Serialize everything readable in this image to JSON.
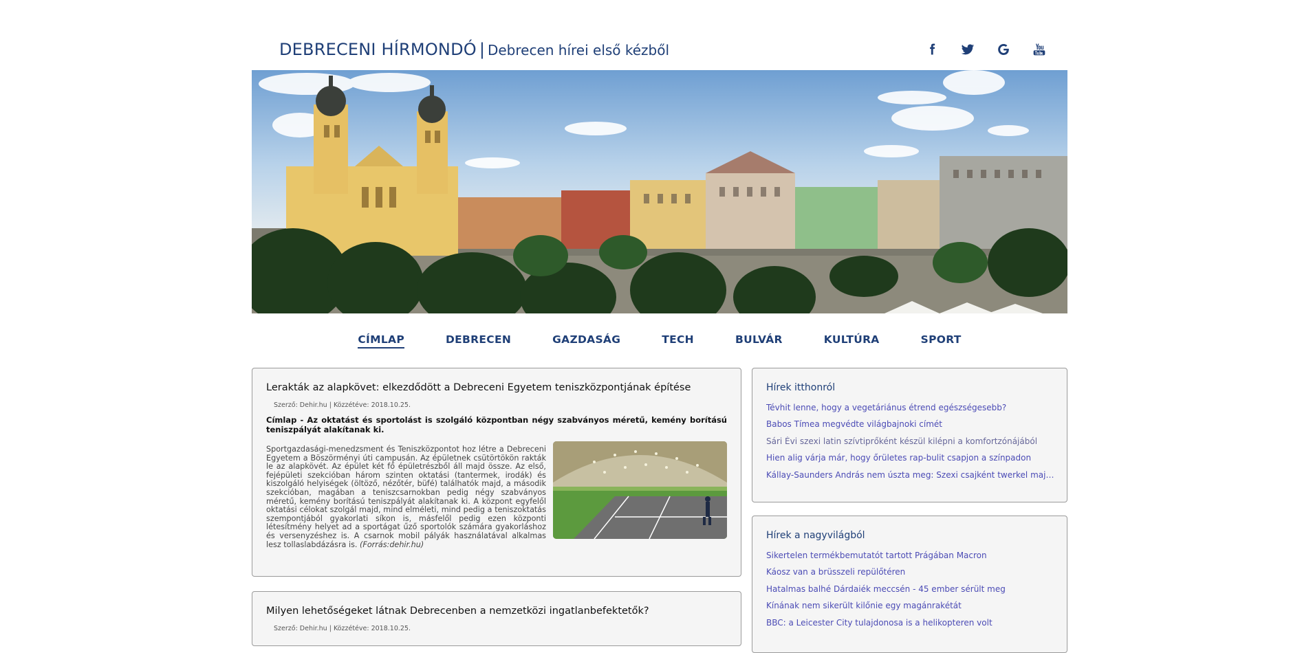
{
  "header": {
    "brand": "DEBRECENI HÍRMONDÓ",
    "separator": "|",
    "tagline": "Debrecen hírei első kézből",
    "socials": [
      {
        "icon": "facebook-icon"
      },
      {
        "icon": "twitter-icon"
      },
      {
        "icon": "google-icon"
      },
      {
        "icon": "youtube-icon"
      }
    ]
  },
  "nav": {
    "items": [
      {
        "label": "CÍMLAP",
        "active": true
      },
      {
        "label": "DEBRECEN"
      },
      {
        "label": "GAZDASÁG"
      },
      {
        "label": "TECH"
      },
      {
        "label": "BULVÁR"
      },
      {
        "label": "KULTÚRA"
      },
      {
        "label": "SPORT"
      }
    ]
  },
  "articles": [
    {
      "title": "Lerakták az alapkövet: elkezdődött a Debreceni Egyetem teniszközpontjának építése",
      "meta": "Szerző: Dehir.hu | Közzétéve: 2018.10.25.",
      "lead": "Címlap - Az oktatást és sportolást is szolgáló központban négy szabványos méretű, kemény borítású teniszpályát alakítanak ki.",
      "body": "Sportgazdasági-menedzsment és Teniszközpontot hoz létre a Debreceni Egyetem a Böszörményi úti campusán. Az épületnek csütörtökön rakták le az alapkövét. Az épület két fő épületrészből áll majd össze. Az első, fejépületi szekcióban három szinten oktatási (tantermek, irodák) és kiszolgáló helyiségek (öltöző, nézőtér, büfé) találhatók majd, a második szekcióban, magában a teniszcsarnokban pedig négy szabványos méretű, kemény borítású teniszpályát alakítanak ki. A központ egyfelől oktatási célokat szolgál majd, mind elméleti, mind pedig a teniszoktatás szempontjából gyakorlati síkon is, másfelől pedig ezen központi létesítmény helyet ad a sportágat űző sportolók számára gyakorláshoz és versenyzéshez is. A csarnok mobil pályák használatával alkalmas lesz tollaslabdázásra is.",
      "source": "(Forrás:dehir.hu)"
    },
    {
      "title": "Milyen lehetőségeket látnak Debrecenben a nemzetközi ingatlanbefektetők?",
      "meta": "Szerző: Dehir.hu | Közzétéve: 2018.10.25."
    }
  ],
  "sidebar": {
    "home": {
      "title": "Hírek itthonról",
      "items": [
        "Tévhit lenne, hogy a vegetáriánus étrend egészségesebb?",
        "Babos Tímea megvédte világbajnoki címét",
        "Sári Évi szexi latin szívtiprőként készül kilépni a komfortzónájából",
        "Hien alig várja már, hogy őrületes rap-bulit csapjon a színpadon",
        "Kállay-Saunders András nem úszta meg: Szexi csajként twerkel majd a szín..."
      ]
    },
    "world": {
      "title": "Hírek a nagyvilágból",
      "items": [
        "Sikertelen termékbemutatót tartott Prágában Macron",
        "Káosz van a brüsszeli repülőtéren",
        "Hatalmas balhé Dárdaiék meccsén - 45 ember sérült meg",
        "Kínának nem sikerült kilőnie egy magánrakétát",
        "BBC: a Leicester City tulajdonosa is a helikopteren volt"
      ]
    }
  }
}
